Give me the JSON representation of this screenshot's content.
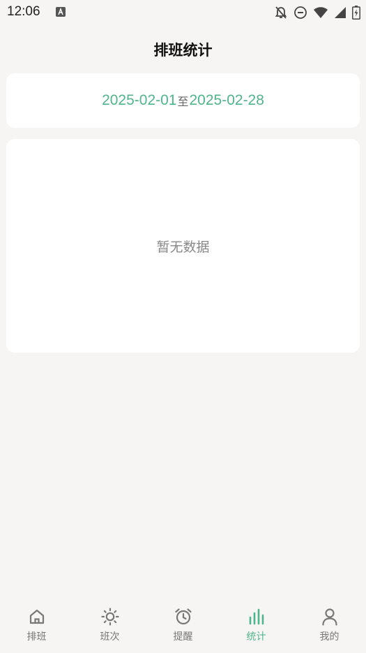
{
  "status_bar": {
    "time": "12:06",
    "icons": [
      "font-app-icon",
      "bell-off-icon",
      "do-not-disturb-icon",
      "wifi-icon",
      "signal-icon",
      "battery-charging-icon"
    ]
  },
  "header": {
    "title": "排班统计"
  },
  "date_range": {
    "start": "2025-02-01",
    "separator": "至",
    "end": "2025-02-28"
  },
  "stats": {
    "empty_text": "暂无数据"
  },
  "tabs": [
    {
      "label": "排班",
      "icon": "home-icon",
      "active": false
    },
    {
      "label": "班次",
      "icon": "sun-icon",
      "active": false
    },
    {
      "label": "提醒",
      "icon": "alarm-clock-icon",
      "active": false
    },
    {
      "label": "统计",
      "icon": "bar-chart-icon",
      "active": true
    },
    {
      "label": "我的",
      "icon": "user-icon",
      "active": false
    }
  ],
  "colors": {
    "accent": "#4fb58a",
    "background": "#f6f5f3",
    "card": "#ffffff",
    "inactive": "#777777"
  }
}
